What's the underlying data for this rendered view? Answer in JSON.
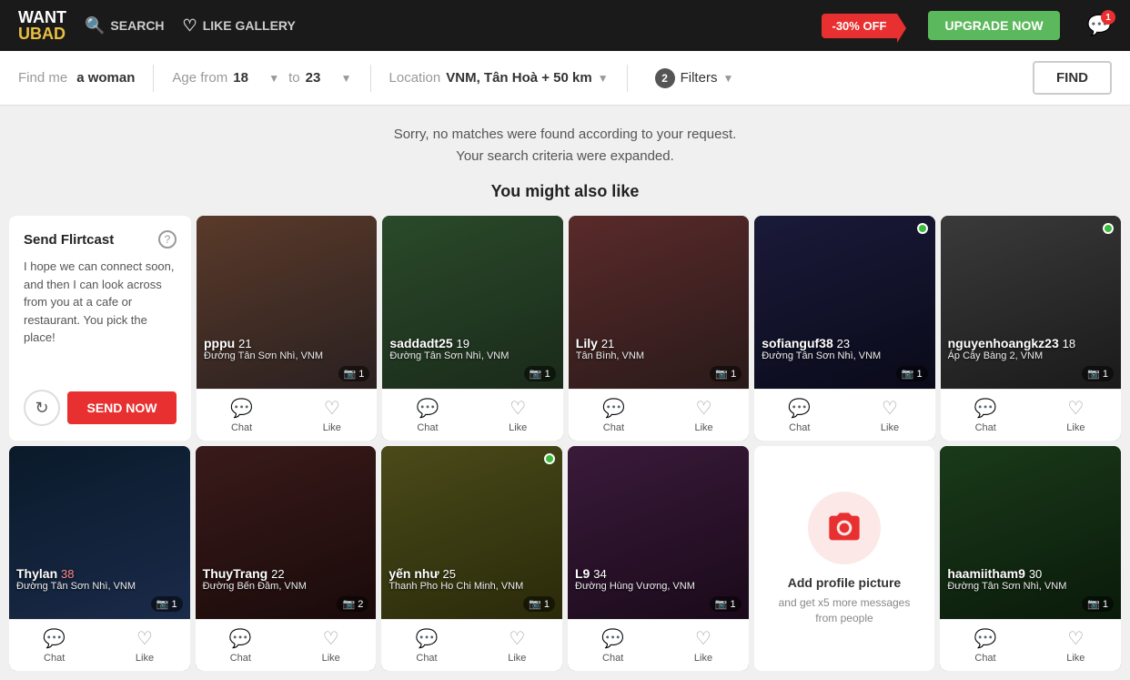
{
  "header": {
    "logo_want": "WANT",
    "logo_ubad": "UBAD",
    "search_label": "SEARCH",
    "like_gallery_label": "LIKE GALLERY",
    "discount_label": "-30% OFF",
    "upgrade_label": "UPGRADE NOW",
    "notif_count": "1"
  },
  "searchbar": {
    "find_me_label": "Find me",
    "find_me_value": "a woman",
    "age_from_label": "Age from",
    "age_from_value": "18",
    "age_to_label": "to",
    "age_to_value": "23",
    "location_label": "Location",
    "location_value": "VNM, Tân Hoà + 50 km",
    "filters_label": "Filters",
    "filters_count": "2",
    "find_label": "FIND"
  },
  "messages": {
    "no_matches": "Sorry, no matches were found according to your request.",
    "criteria_expanded": "Your search criteria were expanded.",
    "you_might_like": "You might also like"
  },
  "flirtcast": {
    "title": "Send Flirtcast",
    "message": "I hope we can connect soon, and then I can look across from you at a cafe or restaurant. You pick the place!",
    "send_label": "SEND NOW"
  },
  "profiles_row1": [
    {
      "username": "pppu",
      "age": "21",
      "location": "Đường Tân Sơn Nhì, VNM",
      "photos": "1",
      "online": false,
      "bg": "#3a3030"
    },
    {
      "username": "saddadt25",
      "age": "19",
      "location": "Đường Tân Sơn Nhì, VNM",
      "photos": "1",
      "online": false,
      "bg": "#2d3a2d"
    },
    {
      "username": "Lily",
      "age": "21",
      "location": "Tân Bình, VNM",
      "photos": "1",
      "online": false,
      "bg": "#3a2a2a"
    },
    {
      "username": "sofianguf38",
      "age": "23",
      "location": "Đường Tân Sơn Nhì, VNM",
      "photos": "1",
      "online": true,
      "bg": "#1a1a2a"
    },
    {
      "username": "nguyenhoangkz23",
      "age": "18",
      "location": "Áp Cây Bàng 2, VNM",
      "photos": "1",
      "online": true,
      "bg": "#2a2a2a"
    }
  ],
  "profiles_row2": [
    {
      "username": "Thylan",
      "age": "38",
      "location": "Đường Tân Sơn Nhì, VNM",
      "photos": "1",
      "online": false,
      "bg": "#1a2a3a"
    },
    {
      "username": "ThuyTrang",
      "age": "22",
      "location": "Đường Bến Đầm, VNM",
      "photos": "2",
      "online": false,
      "bg": "#2a1a1a"
    },
    {
      "username": "yến như",
      "age": "25",
      "location": "Thanh Pho Ho Chi Minh, VNM",
      "photos": "1",
      "online": true,
      "bg": "#3a3a1a"
    },
    {
      "username": "L9",
      "age": "34",
      "location": "Đường Hùng Vương, VNM",
      "photos": "1",
      "online": false,
      "bg": "#2a1a2a"
    },
    {
      "username": "haamiitham9",
      "age": "30",
      "location": "Đường Tân Sơn Nhì, VNM",
      "photos": "1",
      "online": false,
      "bg": "#1a2a1a"
    }
  ],
  "add_photo": {
    "title": "Add profile picture",
    "subtitle": "and get x5 more messages from people"
  },
  "actions": {
    "chat_label": "Chat",
    "like_label": "Like"
  }
}
